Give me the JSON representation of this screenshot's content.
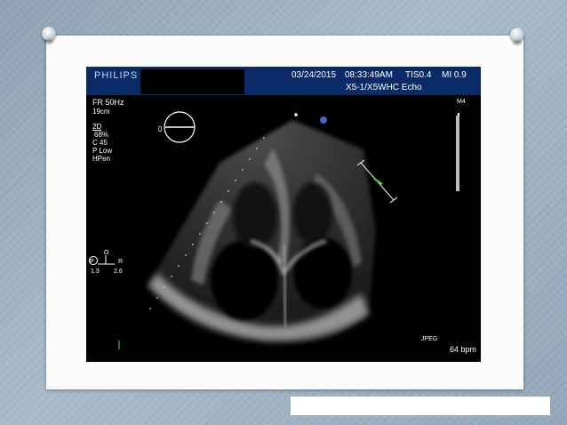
{
  "header": {
    "brand": "PHILIPS",
    "date": "03/24/2015",
    "time": "08:33:49AM",
    "tis": "TIS0.4",
    "mi": "MI 0.9",
    "probe": "X5-1/X5WHC Echo"
  },
  "left_panel": {
    "fr": "FR 50Hz",
    "depth": "19cm",
    "mode": "2D",
    "gain": "68%",
    "compress": "C 45",
    "power": "P Low",
    "harmonic": "HPen"
  },
  "orientation": {
    "zero": "0"
  },
  "scale_marker": {
    "label": "M4"
  },
  "compass": {
    "o": "O",
    "p": "P",
    "r": "R",
    "v1": "1.3",
    "v2": "2.6"
  },
  "footer": {
    "jpeg": "JPEG",
    "bpm": "64 bpm"
  }
}
